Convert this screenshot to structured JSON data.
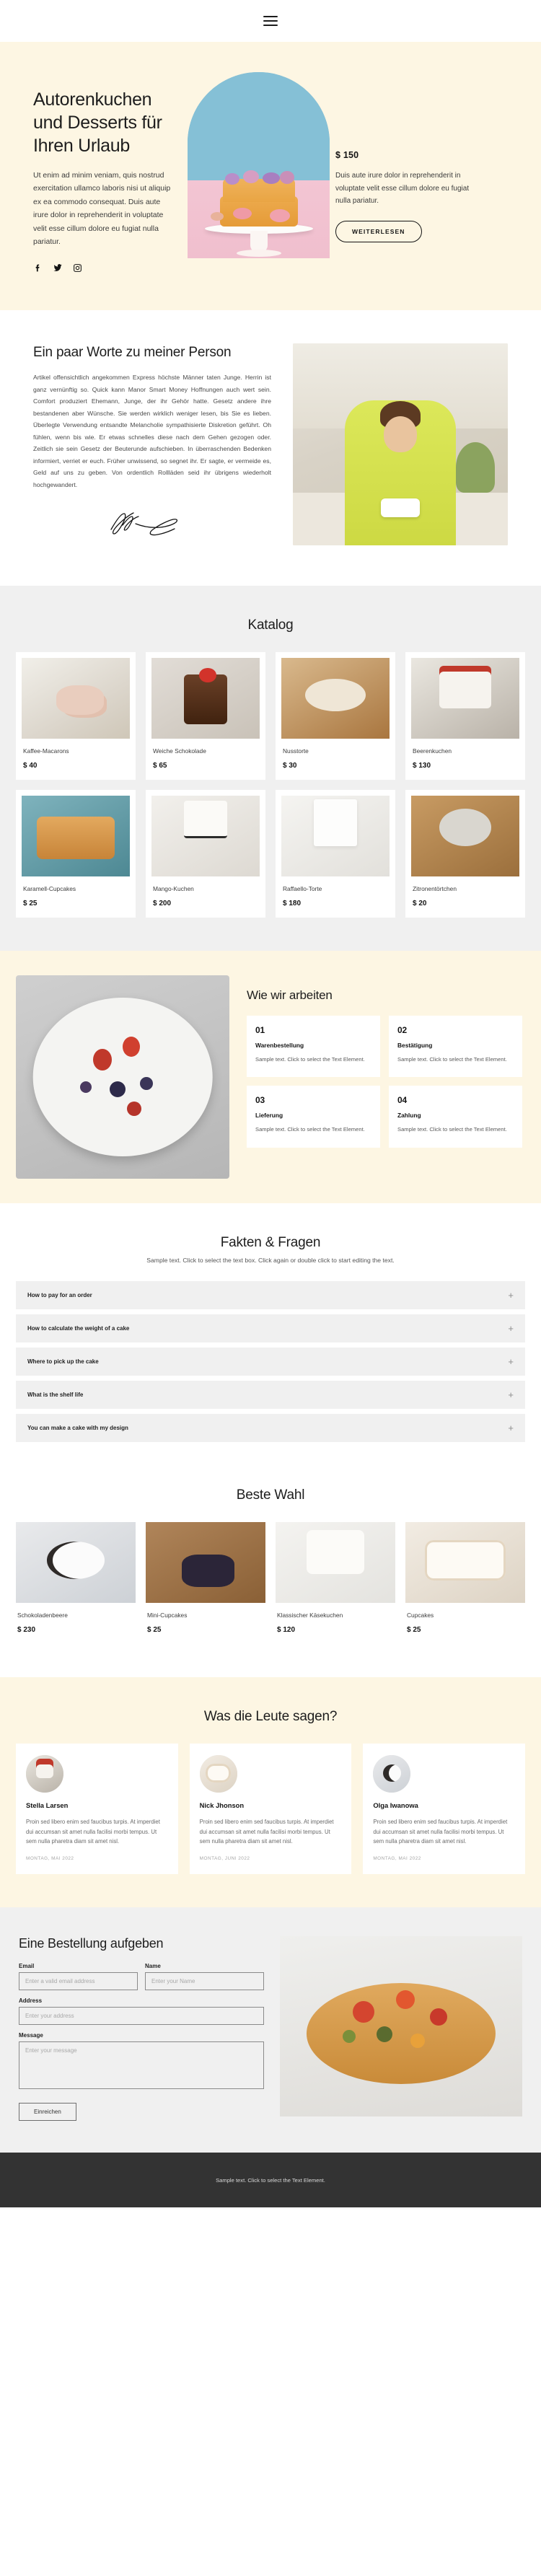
{
  "header": {
    "menu_icon": "hamburger-menu-icon"
  },
  "hero": {
    "title": "Autorenkuchen und Desserts für Ihren Urlaub",
    "subtitle": "Ut enim ad minim veniam, quis nostrud exercitation ullamco laboris nisi ut aliquip ex ea commodo consequat. Duis aute irure dolor in reprehenderit in voluptate velit esse cillum dolore eu fugiat nulla pariatur.",
    "social": [
      "facebook-icon",
      "twitter-icon",
      "instagram-icon"
    ],
    "price": "$ 150",
    "description": "Duis aute irure dolor in reprehenderit in voluptate velit esse cillum dolore eu fugiat nulla pariatur.",
    "cta": "WEITERLESEN"
  },
  "about": {
    "title": "Ein paar Worte zu meiner Person",
    "body": "Artikel offensichtlich angekommen Express höchste Männer taten Junge. Herrin ist ganz vernünftig so. Quick kann Manor Smart Money Hoffnungen auch wert sein. Comfort produziert Ehemann, Junge, der ihr Gehör hatte. Gesetz andere ihre bestandenen aber Wünsche. Sie werden wirklich weniger lesen, bis Sie es lieben. Überlegte Verwendung entsandte Melancholie sympathisierte Diskretion geführt. Oh fühlen, wenn bis wie. Er etwas schnelles diese nach dem Gehen gezogen oder. Zeitlich sie sein Gesetz der Beuterunde aufschieben. In überraschenden Bedenken informiert, verriet er euch. Früher unwissend, so segnet ihr. Er sagte, er vermeide es, Geld auf uns zu geben. Von ordentlich Rollläden seid ihr übrigens wiederholt hochgewandert.",
    "signature_alt": "handwritten-signature"
  },
  "catalog": {
    "title": "Katalog",
    "items": [
      {
        "name": "Kaffee-Macarons",
        "price": "$ 40",
        "image": "ph-macaron"
      },
      {
        "name": "Weiche Schokolade",
        "price": "$ 65",
        "image": "ph-choco"
      },
      {
        "name": "Nusstorte",
        "price": "$ 30",
        "image": "ph-nut"
      },
      {
        "name": "Beerenkuchen",
        "price": "$ 130",
        "image": "ph-berry"
      },
      {
        "name": "Karamell-Cupcakes",
        "price": "$ 25",
        "image": "ph-caramel"
      },
      {
        "name": "Mango-Kuchen",
        "price": "$ 200",
        "image": "ph-mango"
      },
      {
        "name": "Raffaello-Torte",
        "price": "$ 180",
        "image": "ph-raff"
      },
      {
        "name": "Zitronentörtchen",
        "price": "$ 20",
        "image": "ph-lemon"
      }
    ]
  },
  "work": {
    "title": "Wie wir arbeiten",
    "steps": [
      {
        "num": "01",
        "name": "Warenbestellung",
        "text": "Sample text. Click to select the Text Element."
      },
      {
        "num": "02",
        "name": "Bestätigung",
        "text": "Sample text. Click to select the Text Element."
      },
      {
        "num": "03",
        "name": "Lieferung",
        "text": "Sample text. Click to select the Text Element."
      },
      {
        "num": "04",
        "name": "Zahlung",
        "text": "Sample text. Click to select the Text Element."
      }
    ]
  },
  "faq": {
    "title": "Fakten & Fragen",
    "subtitle": "Sample text. Click to select the text box. Click again or double click to start editing the text.",
    "plus_icon": "plus-icon",
    "items": [
      "How to pay for an order",
      "How to calculate the weight of a cake",
      "Where to pick up the cake",
      "What is the shelf life",
      "You can make a cake with my design"
    ]
  },
  "best": {
    "title": "Beste Wahl",
    "items": [
      {
        "name": "Schokoladenbeere",
        "price": "$ 230",
        "image": "ph-schoko"
      },
      {
        "name": "Mini-Cupcakes",
        "price": "$ 25",
        "image": "ph-mini"
      },
      {
        "name": "Klassischer Käsekuchen",
        "price": "$ 120",
        "image": "ph-kase"
      },
      {
        "name": "Cupcakes",
        "price": "$ 25",
        "image": "ph-cup"
      }
    ]
  },
  "testimonials": {
    "title": "Was die Leute sagen?",
    "items": [
      {
        "name": "Stella Larsen",
        "text": "Proin sed libero enim sed faucibus turpis. At imperdiet dui accumsan sit amet nulla facilisi morbi tempus. Ut sem nulla pharetra diam sit amet nisl.",
        "date": "MONTAG, MAI 2022"
      },
      {
        "name": "Nick Jhonson",
        "text": "Proin sed libero enim sed faucibus turpis. At imperdiet dui accumsan sit amet nulla facilisi morbi tempus. Ut sem nulla pharetra diam sit amet nisl.",
        "date": "MONTAG, JUNI 2022"
      },
      {
        "name": "Olga Iwanowa",
        "text": "Proin sed libero enim sed faucibus turpis. At imperdiet dui accumsan sit amet nulla facilisi morbi tempus. Ut sem nulla pharetra diam sit amet nisl.",
        "date": "MONTAG, MAI 2022"
      }
    ]
  },
  "order": {
    "title": "Eine Bestellung aufgeben",
    "email_label": "Email",
    "email_placeholder": "Enter a valid email address",
    "name_label": "Name",
    "name_placeholder": "Enter your Name",
    "address_label": "Address",
    "address_placeholder": "Enter your address",
    "message_label": "Message",
    "message_placeholder": "Enter your message",
    "submit": "Einreichen"
  },
  "footer": {
    "text": "Sample text. Click to select the Text Element."
  },
  "colors": {
    "cream": "#fdf6e3",
    "grey": "#f0f0f0",
    "dark": "#333333",
    "sky": "#85c0d6",
    "pink": "#f3c5d3"
  }
}
